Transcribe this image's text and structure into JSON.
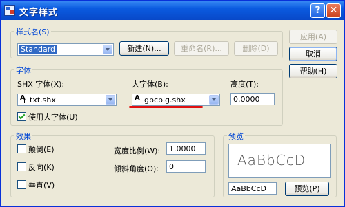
{
  "window": {
    "title": "文字样式",
    "help_glyph": "?",
    "close_glyph": "✕"
  },
  "style_name": {
    "legend": "样式名(S)",
    "selected": "Standard",
    "new_button": "新建(N)...",
    "rename_button": "重命名(R)...",
    "delete_button": "删除(D)"
  },
  "side_buttons": {
    "apply": "应用(A)",
    "cancel": "取消",
    "help": "帮助(H)"
  },
  "font": {
    "legend": "字体",
    "shx_label": "SHX 字体(X):",
    "shx_value": "txt.shx",
    "bigfont_label": "大字体(B):",
    "bigfont_value": "gbcbig.shx",
    "height_label": "高度(T):",
    "height_value": "0.0000",
    "use_bigfont_label": "使用大字体(U)",
    "use_bigfont_checked": true
  },
  "effects": {
    "legend": "效果",
    "upside_down_label": "颠倒(E)",
    "backwards_label": "反向(K)",
    "vertical_label": "垂直(V)",
    "width_factor_label": "宽度比例(W):",
    "width_factor_value": "1.0000",
    "oblique_label": "倾斜角度(O):",
    "oblique_value": "0"
  },
  "preview": {
    "legend": "预览",
    "sample_text": "AaBbCcD",
    "input_value": "AaBbCcD",
    "button": "预览(P)"
  },
  "icons": {
    "app": "text-style-icon",
    "font": "font-type-icon"
  },
  "colors": {
    "title_bar": "#0a5be0",
    "legend_text": "#0046d5",
    "highlight": "#316ac5",
    "annotation": "#e01010"
  }
}
